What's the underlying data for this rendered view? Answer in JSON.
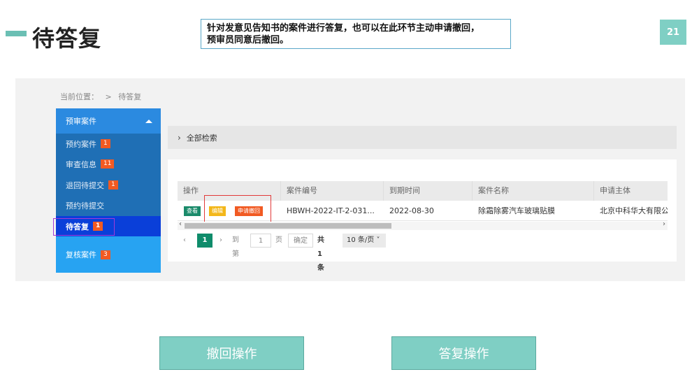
{
  "slide": {
    "title": "待答复",
    "note_line1": "针对发意见告知书的案件进行答复，也可以在此环节主动申请撤回，",
    "note_line2": "预审员同意后撤回。",
    "page_number": "21"
  },
  "breadcrumb": {
    "label": "当前位置：",
    "sep": ">",
    "current": "待答复"
  },
  "sidebar": {
    "header": "预审案件",
    "items": [
      {
        "label": "预约案件",
        "badge": "1"
      },
      {
        "label": "审查信息",
        "badge": "11"
      },
      {
        "label": "退回待提交",
        "badge": "1"
      },
      {
        "label": "预约待提交",
        "badge": ""
      },
      {
        "label": "待答复",
        "badge": "1"
      }
    ],
    "review": {
      "label": "复核案件",
      "badge": "3"
    }
  },
  "search": {
    "label": "全部检索"
  },
  "table": {
    "columns": [
      "操作",
      "案件编号",
      "到期时间",
      "案件名称",
      "申请主体"
    ],
    "row": {
      "actions": {
        "view": "查看",
        "edit": "编辑",
        "withdraw": "申请撤回"
      },
      "case_no": "HBWH-2022-IT-2-031...",
      "due": "2022-08-30",
      "name": "除霜除雾汽车玻璃贴膜",
      "applicant": "北京中科华大有限公司"
    }
  },
  "pagination": {
    "current": "1",
    "goto_label": "到第",
    "goto_value": "1",
    "page_unit": "页",
    "confirm": "确定",
    "total": "共 1 条",
    "page_size": "10 条/页"
  },
  "buttons": {
    "withdraw_op": "撤回操作",
    "reply_op": "答复操作"
  }
}
